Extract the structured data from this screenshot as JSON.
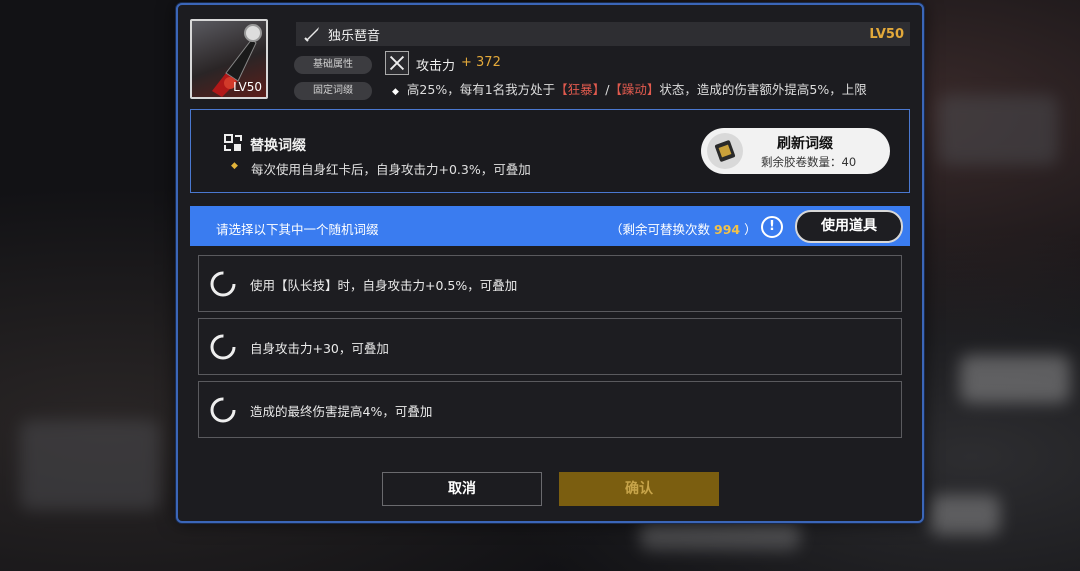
{
  "weapon": {
    "name": "独乐琶音",
    "level": "LV50",
    "thumb_level": "LV50",
    "icon": "electric-guitar-icon"
  },
  "base_attr": {
    "tag": "基础属性",
    "stat_label": "攻击力",
    "stat_value": "+ 372"
  },
  "fixed_affix": {
    "tag": "固定词缀",
    "text_pre": "高25%，每有1名我方处于",
    "buff1": "【狂暴】",
    "sep": "/",
    "buff2": "【躁动】",
    "text_post": "状态，造成的伤害额外提高5%，上限"
  },
  "replace": {
    "title": "替换词缀",
    "description": "每次使用自身红卡后，自身攻击力+0.3%，可叠加",
    "refresh_title": "刷新词缀",
    "refresh_count": "剩余胶卷数量：40"
  },
  "select_bar": {
    "hint": "请选择以下其中一个随机词缀",
    "remain_pre": "（剩余可替换次数",
    "remain_num": "994",
    "remain_post": "）",
    "use_item": "使用道具"
  },
  "options": [
    {
      "text": "使用【队长技】时，自身攻击力+0.5%，可叠加"
    },
    {
      "text": "自身攻击力+30，可叠加"
    },
    {
      "text": "造成的最终伤害提高4%，可叠加"
    }
  ],
  "buttons": {
    "cancel": "取消",
    "confirm": "确认"
  },
  "colors": {
    "accent_blue": "#3a7cf0",
    "gold": "#e3a93a",
    "buff_red": "#e15a4e",
    "confirm_disabled": "#7b5e10"
  }
}
